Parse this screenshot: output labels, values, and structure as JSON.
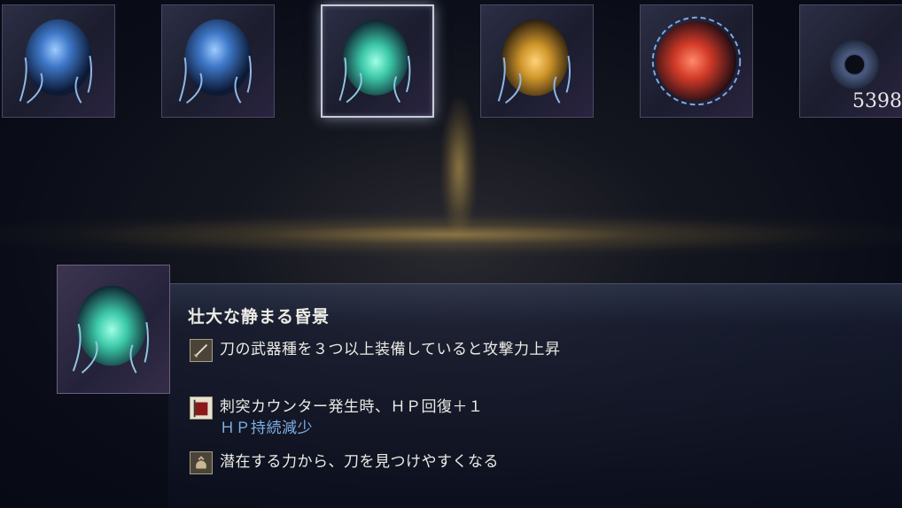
{
  "relic_row": {
    "slots": [
      {
        "name": "relic-blue",
        "color": "#3f78c8"
      },
      {
        "name": "relic-blue",
        "color": "#3f78c8"
      },
      {
        "name": "relic-green",
        "color": "#3cc8a8",
        "selected": true
      },
      {
        "name": "relic-yellow",
        "color": "#d0962a"
      },
      {
        "name": "relic-red",
        "color": "#d23a28"
      },
      {
        "name": "relic-dark-orb",
        "color": "#4a5a80"
      }
    ],
    "currency_count": "5398"
  },
  "detail": {
    "title": "壮大な静まる昏景",
    "effects": [
      {
        "icon": "sword-icon",
        "text": "刀の武器種を３つ以上装備していると攻撃力上昇",
        "subtext": ""
      },
      {
        "icon": "red-banner-icon",
        "text": "刺突カウンター発生時、ＨＰ回復＋１",
        "subtext": "ＨＰ持続減少"
      },
      {
        "icon": "pouch-icon",
        "text": "潜在する力から、刀を見つけやすくなる",
        "subtext": ""
      }
    ]
  },
  "colors": {
    "accent_gold": "#d6b054",
    "subtext_blue": "#7fb0e6",
    "selected_border": "#c9ccd8"
  }
}
